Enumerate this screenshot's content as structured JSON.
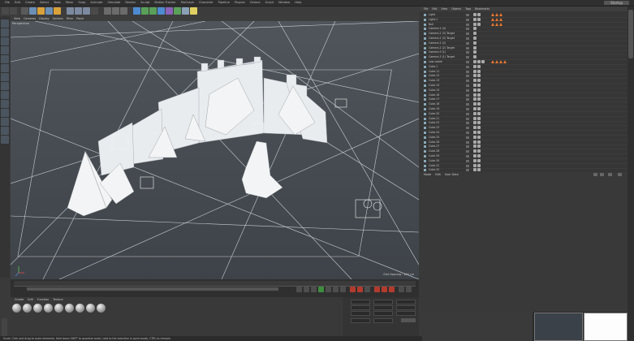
{
  "app": {
    "layout_tag": "Startup"
  },
  "menubar": {
    "items": [
      "File",
      "Edit",
      "Create",
      "Select",
      "Tools",
      "Mesh",
      "Snap",
      "Animate",
      "Simulate",
      "Render",
      "Sculpt",
      "Motion Tracker",
      "MoGraph",
      "Character",
      "Pipeline",
      "Plugins",
      "Octane",
      "Script",
      "Window",
      "Help"
    ]
  },
  "viewport": {
    "menu": [
      "View",
      "Cameras",
      "Display",
      "Options",
      "Filter",
      "Panel"
    ],
    "label": "Perspective",
    "grid_spacing": "Grid Spacing : 100 cm"
  },
  "timeline": {},
  "materials": {
    "menu": [
      "Create",
      "Edit",
      "Function",
      "Texture"
    ],
    "count": 9
  },
  "coords": {},
  "status": {
    "text": "Scale: Click and drag to scale elements. Hold down SHIFT to quantize scale / add to the selection in point mode, CTRL to remove."
  },
  "object_manager": {
    "menu": [
      "File",
      "Edit",
      "View",
      "Objects",
      "Tags",
      "Bookmarks"
    ],
    "rows": [
      {
        "name": "Light"
      },
      {
        "name": "Light.1"
      },
      {
        "name": "Null"
      },
      {
        "name": "Camera.1 (4)"
      },
      {
        "name": "Camera.2 (3) Target"
      },
      {
        "name": "Camera.2 (3) Target"
      },
      {
        "name": "Camera.2 (2)"
      },
      {
        "name": "Camera.2 (2) Target"
      },
      {
        "name": "Camera.3 (1)"
      },
      {
        "name": "Camera.3 (1) Target"
      },
      {
        "name": "Low castle"
      },
      {
        "name": "Cube.1"
      },
      {
        "name": "Cube.11"
      },
      {
        "name": "Cube.12"
      },
      {
        "name": "Cube.13"
      },
      {
        "name": "Cube.14"
      },
      {
        "name": "Cube.15"
      },
      {
        "name": "Cube.16"
      },
      {
        "name": "Cube.17"
      },
      {
        "name": "Cube.18"
      },
      {
        "name": "Cube.19"
      },
      {
        "name": "Cube.20"
      },
      {
        "name": "Cube.21"
      },
      {
        "name": "Cube.22"
      },
      {
        "name": "Cube.23"
      },
      {
        "name": "Cube.24"
      },
      {
        "name": "Cube.25"
      },
      {
        "name": "Cube.26"
      },
      {
        "name": "Cube.27"
      },
      {
        "name": "Cube.28"
      },
      {
        "name": "Cube.29"
      },
      {
        "name": "Cube.30"
      },
      {
        "name": "Cube.31"
      },
      {
        "name": "Cube.32"
      }
    ]
  },
  "attribute_manager": {
    "menu": [
      "Mode",
      "Edit",
      "User Data"
    ]
  },
  "colors": {
    "tag_orange": "#e8772e",
    "viewport_bg": "#4a5056",
    "wire": "#d8dde2"
  }
}
